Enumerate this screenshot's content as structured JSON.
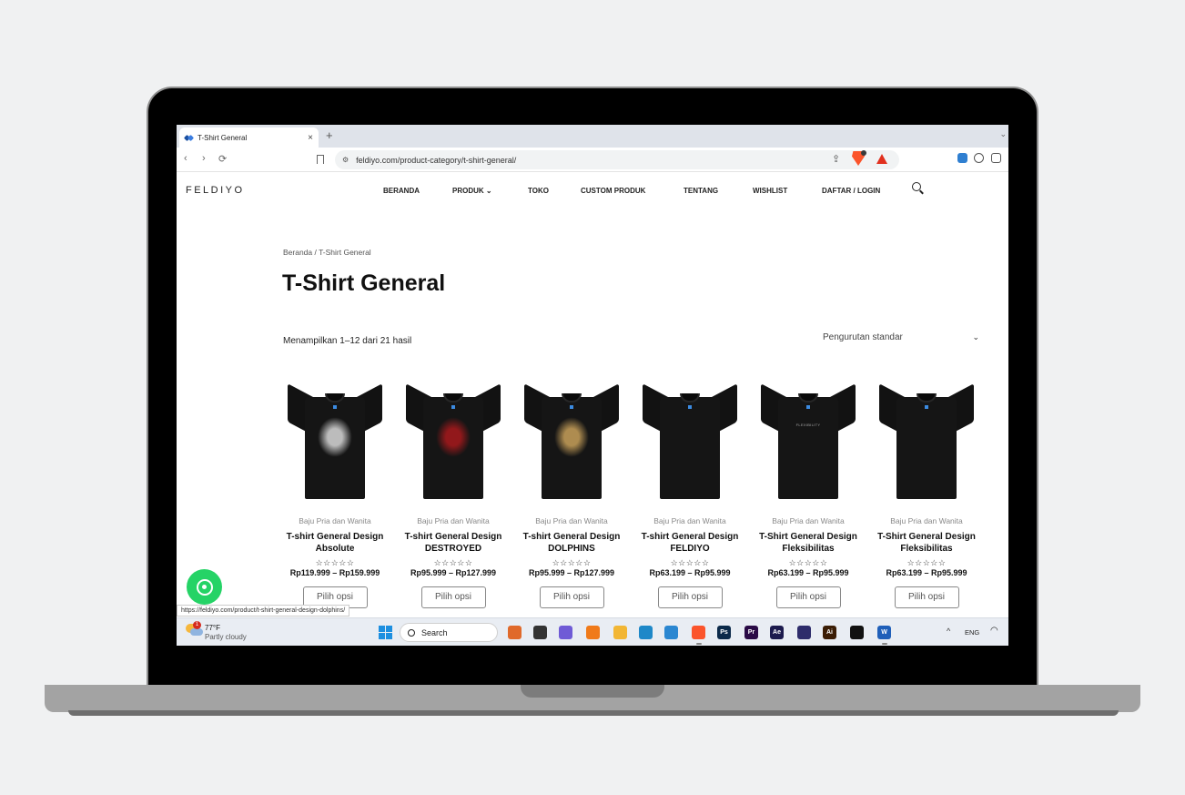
{
  "browser": {
    "tab_title": "T-Shirt General",
    "tab_close": "×",
    "new_tab": "+",
    "back": "‹",
    "forward": "›",
    "reload": "⟳",
    "url": "feldiyo.com/product-category/t-shirt-general/",
    "status_url": "https://feldiyo.com/product/t-shirt-general-design-dolphins/"
  },
  "site": {
    "logo": "FELDIYO",
    "menu": [
      "BERANDA",
      "PRODUK ⌄",
      "TOKO",
      "CUSTOM PRODUK",
      "TENTANG",
      "WISHLIST",
      "DAFTAR / LOGIN"
    ]
  },
  "page": {
    "breadcrumb": "Beranda / T-Shirt General",
    "title": "T-Shirt General",
    "result_count": "Menampilkan 1–12 dari 21 hasil",
    "sort_value": "Pengurutan standar"
  },
  "products": [
    {
      "category": "Baju Pria dan Wanita",
      "name": "T-shirt General Design Absolute",
      "rating": "☆☆☆☆☆",
      "price": "Rp119.999 – Rp159.999",
      "button": "Pilih opsi",
      "print_color": "#d9d9d9",
      "print_text": ""
    },
    {
      "category": "Baju Pria dan Wanita",
      "name": "T-shirt General Design DESTROYED",
      "rating": "☆☆☆☆☆",
      "price": "Rp95.999 – Rp127.999",
      "button": "Pilih opsi",
      "print_color": "#a8191c",
      "print_text": ""
    },
    {
      "category": "Baju Pria dan Wanita",
      "name": "T-shirt General Design DOLPHINS",
      "rating": "☆☆☆☆☆",
      "price": "Rp95.999 – Rp127.999",
      "button": "Pilih opsi",
      "print_color": "#c9a15a",
      "print_text": ""
    },
    {
      "category": "Baju Pria dan Wanita",
      "name": "T-shirt General Design FELDIYO",
      "rating": "☆☆☆☆☆",
      "price": "Rp63.199 – Rp95.999",
      "button": "Pilih opsi",
      "print_color": "",
      "print_text": ""
    },
    {
      "category": "Baju Pria dan Wanita",
      "name": "T-Shirt General Design Fleksibilitas",
      "rating": "☆☆☆☆☆",
      "price": "Rp63.199 – Rp95.999",
      "button": "Pilih opsi",
      "print_color": "",
      "print_text": "FLEXIBILITY"
    },
    {
      "category": "Baju Pria dan Wanita",
      "name": "T-Shirt General Design Fleksibilitas",
      "rating": "☆☆☆☆☆",
      "price": "Rp63.199 – Rp95.999",
      "button": "Pilih opsi",
      "print_color": "",
      "print_text": ""
    }
  ],
  "taskbar": {
    "temperature": "77°F",
    "condition": "Partly cloudy",
    "notification_count": "1",
    "search_label": "Search",
    "apps": [
      {
        "name": "kiddle",
        "label": "",
        "color": "#e0692a"
      },
      {
        "name": "task-view",
        "label": "",
        "color": "#333333"
      },
      {
        "name": "copilot",
        "label": "",
        "color": "#6f5bd6"
      },
      {
        "name": "xampp",
        "label": "",
        "color": "#f07a1a"
      },
      {
        "name": "file-explorer",
        "label": "",
        "color": "#f2b634"
      },
      {
        "name": "edge",
        "label": "",
        "color": "#1e88c8"
      },
      {
        "name": "vscode",
        "label": "",
        "color": "#2b87d1"
      },
      {
        "name": "brave",
        "label": "",
        "color": "#fb542b"
      },
      {
        "name": "photoshop",
        "label": "Ps",
        "color": "#0c2a4a"
      },
      {
        "name": "premiere",
        "label": "Pr",
        "color": "#2a0a45"
      },
      {
        "name": "after-effects",
        "label": "Ae",
        "color": "#1c1a4d"
      },
      {
        "name": "obsidian",
        "label": "",
        "color": "#2e2c6b"
      },
      {
        "name": "illustrator",
        "label": "Ai",
        "color": "#3b1d05"
      },
      {
        "name": "capcut",
        "label": "",
        "color": "#111111"
      },
      {
        "name": "word",
        "label": "W",
        "color": "#1f5fb9"
      }
    ],
    "tray_chevron": "^",
    "language": "ENG"
  }
}
